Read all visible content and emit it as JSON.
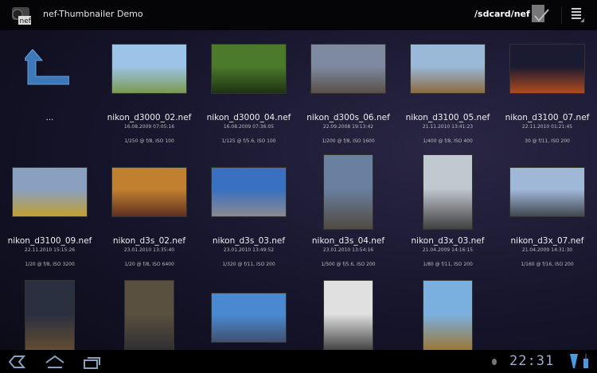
{
  "action_bar": {
    "title": "nef-Thumbnailer Demo",
    "path": "/sdcard/nef",
    "icons": [
      "app-nef-camera-icon",
      "select-check-icon",
      "overflow-menu-icon"
    ]
  },
  "up_item": {
    "label": "...",
    "icon": "up-arrow-icon"
  },
  "files": [
    {
      "name": "nikon_d3000_02.nef",
      "date": "16.08.2009 07:05:16",
      "exposure": "1/250 @ f/8, ISO 100",
      "orient": "land",
      "colors": [
        "#9cc3e8",
        "#7a9a50"
      ]
    },
    {
      "name": "nikon_d3000_04.nef",
      "date": "16.08.2009 07:36:05",
      "exposure": "1/125 @ f/5.6, ISO 100",
      "orient": "land",
      "colors": [
        "#4a7a2a",
        "#1e3312"
      ]
    },
    {
      "name": "nikon_d300s_06.nef",
      "date": "22.09.2008 19:13:42",
      "exposure": "1/200 @ f/8, ISO 1600",
      "orient": "land",
      "colors": [
        "#7d8aa0",
        "#5a5048"
      ]
    },
    {
      "name": "nikon_d3100_05.nef",
      "date": "21.11.2010 13:41:23",
      "exposure": "1/400 @ f/8, ISO 400",
      "orient": "land",
      "colors": [
        "#9ab8d8",
        "#8a6a40"
      ]
    },
    {
      "name": "nikon_d3100_07.nef",
      "date": "22.11.2010 01:21:45",
      "exposure": "30 @ f/11, ISO 200",
      "orient": "land",
      "colors": [
        "#1a1a30",
        "#b04a20"
      ]
    },
    {
      "name": "nikon_d3100_09.nef",
      "date": "22.11.2010 15:15:26",
      "exposure": "1/20 @ f/8, ISO 3200",
      "orient": "land",
      "colors": [
        "#8aa0c0",
        "#c0a030"
      ]
    },
    {
      "name": "nikon_d3s_02.nef",
      "date": "23.01.2010 13:35:40",
      "exposure": "1/20 @ f/8, ISO 6400",
      "orient": "land",
      "colors": [
        "#c08030",
        "#603020"
      ]
    },
    {
      "name": "nikon_d3s_03.nef",
      "date": "23.01.2010 13:49:52",
      "exposure": "1/320 @ f/11, ISO 200",
      "orient": "land",
      "colors": [
        "#3a70c0",
        "#8a8a90"
      ]
    },
    {
      "name": "nikon_d3s_04.nef",
      "date": "23.01.2010 13:54:16",
      "exposure": "1/500 @ f/5.6, ISO 200",
      "orient": "port",
      "colors": [
        "#6a80a0",
        "#504a40"
      ]
    },
    {
      "name": "nikon_d3x_03.nef",
      "date": "21.04.2009 14:16:15",
      "exposure": "1/80 @ f/11, ISO 200",
      "orient": "port",
      "colors": [
        "#c0c8d0",
        "#404040"
      ]
    },
    {
      "name": "nikon_d3x_07.nef",
      "date": "21.04.2009 14:31:30",
      "exposure": "1/160 @ f/16, ISO 200",
      "orient": "land",
      "colors": [
        "#a0b8d8",
        "#404850"
      ]
    }
  ],
  "partial_thumbs": [
    {
      "orient": "port",
      "colors": [
        "#2a3040",
        "#6a5030"
      ]
    },
    {
      "orient": "port",
      "colors": [
        "#5a5040",
        "#2a2a30"
      ]
    },
    {
      "orient": "land",
      "colors": [
        "#4a88d0",
        "#405070"
      ]
    },
    {
      "orient": "port",
      "colors": [
        "#e0e0e0",
        "#303030"
      ]
    },
    {
      "orient": "port",
      "colors": [
        "#7ab0e0",
        "#a07020"
      ]
    }
  ],
  "status_bar": {
    "time": "22:31",
    "icons": [
      "back-icon",
      "home-icon",
      "recent-apps-icon",
      "usb-debug-icon",
      "wifi-icon",
      "battery-icon"
    ]
  }
}
